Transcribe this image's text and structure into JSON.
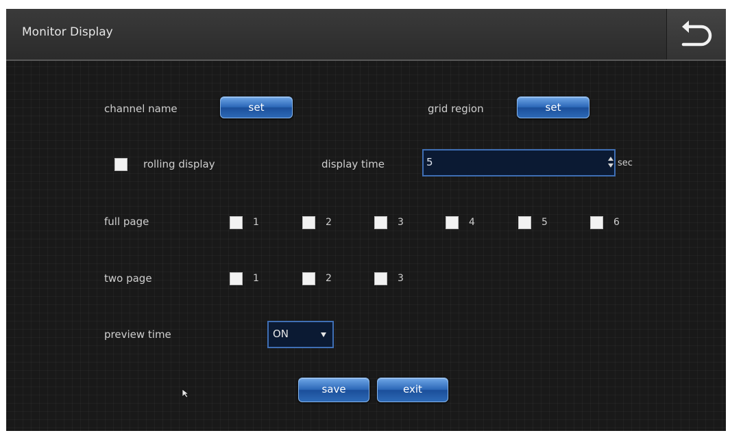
{
  "header": {
    "title": "Monitor Display",
    "back_icon": "back-arrow-icon"
  },
  "channel": {
    "label": "channel name",
    "button": "set"
  },
  "grid": {
    "label": "grid region",
    "button": "set"
  },
  "rolling": {
    "label": "rolling display",
    "checked": false
  },
  "display_time": {
    "label": "display  time",
    "value": "5",
    "unit": "sec"
  },
  "full_page": {
    "label": "full page",
    "options": [
      "1",
      "2",
      "3",
      "4",
      "5",
      "6"
    ]
  },
  "two_page": {
    "label": "two page",
    "options": [
      "1",
      "2",
      "3"
    ]
  },
  "preview_time": {
    "label": "preview time",
    "value": "ON"
  },
  "footer": {
    "save": "save",
    "exit": "exit"
  },
  "colors": {
    "background": "#191919",
    "accent_blue": "#2c68b8",
    "input_bg": "#0b1a33"
  }
}
